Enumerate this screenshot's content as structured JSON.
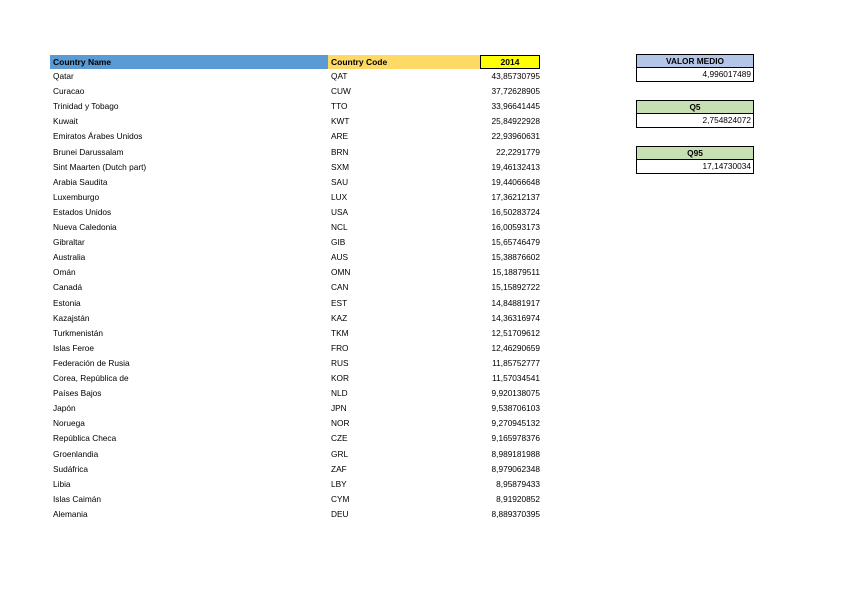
{
  "headers": {
    "country_name": "Country Name",
    "country_code": "Country Code",
    "year": "2014"
  },
  "rows": [
    {
      "name": "Qatar",
      "code": "QAT",
      "value": "43,85730795"
    },
    {
      "name": "Curacao",
      "code": "CUW",
      "value": "37,72628905"
    },
    {
      "name": "Trinidad y Tobago",
      "code": "TTO",
      "value": "33,96641445"
    },
    {
      "name": "Kuwait",
      "code": "KWT",
      "value": "25,84922928"
    },
    {
      "name": "Emiratos Árabes Unidos",
      "code": "ARE",
      "value": "22,93960631"
    },
    {
      "name": "Brunei Darussalam",
      "code": "BRN",
      "value": "22,2291779"
    },
    {
      "name": "Sint Maarten (Dutch part)",
      "code": "SXM",
      "value": "19,46132413"
    },
    {
      "name": "Arabia Saudita",
      "code": "SAU",
      "value": "19,44066648"
    },
    {
      "name": "Luxemburgo",
      "code": "LUX",
      "value": "17,36212137"
    },
    {
      "name": "Estados Unidos",
      "code": "USA",
      "value": "16,50283724"
    },
    {
      "name": "Nueva Caledonia",
      "code": "NCL",
      "value": "16,00593173"
    },
    {
      "name": "Gibraltar",
      "code": "GIB",
      "value": "15,65746479"
    },
    {
      "name": "Australia",
      "code": "AUS",
      "value": "15,38876602"
    },
    {
      "name": "Omán",
      "code": "OMN",
      "value": "15,18879511"
    },
    {
      "name": "Canadá",
      "code": "CAN",
      "value": "15,15892722"
    },
    {
      "name": "Estonia",
      "code": "EST",
      "value": "14,84881917"
    },
    {
      "name": "Kazajstán",
      "code": "KAZ",
      "value": "14,36316974"
    },
    {
      "name": "Turkmenistán",
      "code": "TKM",
      "value": "12,51709612"
    },
    {
      "name": "Islas Feroe",
      "code": "FRO",
      "value": "12,46290659"
    },
    {
      "name": "Federación de Rusia",
      "code": "RUS",
      "value": "11,85752777"
    },
    {
      "name": "Corea, República de",
      "code": "KOR",
      "value": "11,57034541"
    },
    {
      "name": "Países Bajos",
      "code": "NLD",
      "value": "9,920138075"
    },
    {
      "name": "Japón",
      "code": "JPN",
      "value": "9,538706103"
    },
    {
      "name": "Noruega",
      "code": "NOR",
      "value": "9,270945132"
    },
    {
      "name": "República Checa",
      "code": "CZE",
      "value": "9,165978376"
    },
    {
      "name": "Groenlandia",
      "code": "GRL",
      "value": "8,989181988"
    },
    {
      "name": "Sudáfrica",
      "code": "ZAF",
      "value": "8,979062348"
    },
    {
      "name": "Libia",
      "code": "LBY",
      "value": "8,95879433"
    },
    {
      "name": "Islas Caimán",
      "code": "CYM",
      "value": "8,91920852"
    },
    {
      "name": "Alemania",
      "code": "DEU",
      "value": "8,889370395"
    }
  ],
  "stats": {
    "mean_label": "VALOR MEDIO",
    "mean_value": "4,996017489",
    "q5_label": "Q5",
    "q5_value": "2,754824072",
    "q95_label": "Q95",
    "q95_value": "17,14730034"
  },
  "colors": {
    "country_name_header": "#5b9bd5",
    "country_code_header": "#ffd966",
    "year_header": "#ffff00",
    "mean_header": "#b4c6e7",
    "quantile_header": "#c6e0b4"
  }
}
